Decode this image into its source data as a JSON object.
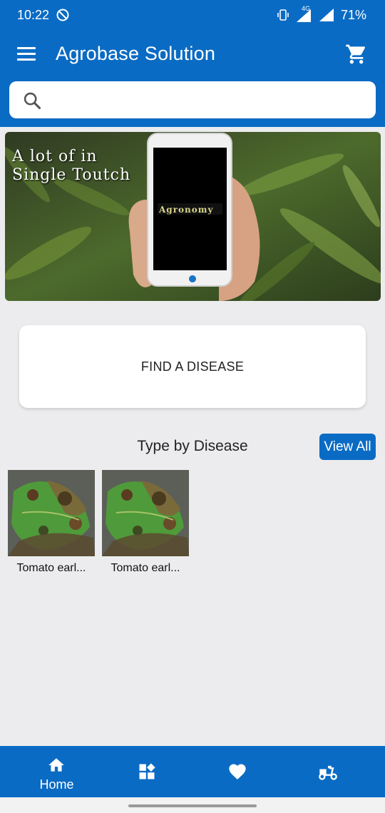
{
  "status_bar": {
    "time": "10:22",
    "network": "4G",
    "battery": "71%"
  },
  "app_bar": {
    "title": "Agrobase Solution"
  },
  "search": {
    "placeholder": "",
    "value": ""
  },
  "banner": {
    "line1": "A lot of in",
    "line2": "Single Toutch",
    "phone_brand": "Agronomy"
  },
  "find_disease": {
    "label": "FIND A DISEASE"
  },
  "section": {
    "title": "Type by Disease",
    "view_all_label": "View All"
  },
  "diseases": [
    {
      "caption": "Tomato earl..."
    },
    {
      "caption": "Tomato earl..."
    }
  ],
  "bottom_nav": {
    "items": [
      {
        "label": "Home",
        "icon": "home-icon"
      },
      {
        "label": "",
        "icon": "categories-icon"
      },
      {
        "label": "",
        "icon": "heart-icon"
      },
      {
        "label": "",
        "icon": "delivery-scooter-icon"
      }
    ]
  },
  "colors": {
    "primary": "#0a6bc4",
    "background": "#ececee"
  }
}
